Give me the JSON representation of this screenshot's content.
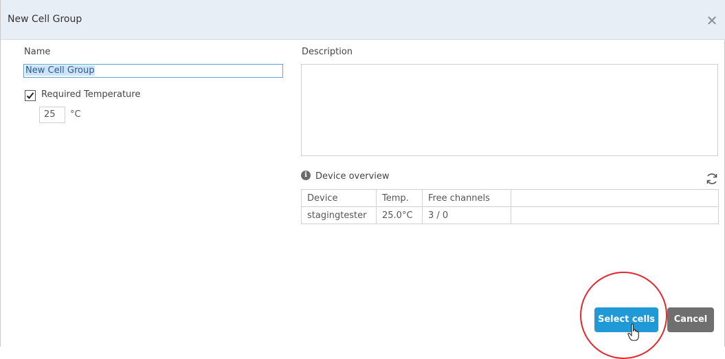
{
  "dialog": {
    "title": "New Cell Group",
    "close_icon": "close-icon"
  },
  "form": {
    "name_label": "Name",
    "name_value": "New Cell Group",
    "required_temp_label": "Required Temperature",
    "required_temp_checked": true,
    "temp_value": "25",
    "temp_unit": "°C",
    "description_label": "Description",
    "description_value": ""
  },
  "device_overview": {
    "title": "Device overview",
    "info_icon": "info-icon",
    "refresh_icon": "refresh-icon",
    "columns": [
      "Device",
      "Temp.",
      "Free channels",
      ""
    ],
    "rows": [
      [
        "stagingtester",
        "25.0°C",
        "3 / 0",
        ""
      ]
    ]
  },
  "buttons": {
    "select_cells": "Select cells",
    "cancel": "Cancel"
  },
  "colors": {
    "primary": "#1f9ad6",
    "secondary": "#6f6f6f",
    "highlight_circle": "#e3262d",
    "titlebar": "#e8eef6"
  }
}
